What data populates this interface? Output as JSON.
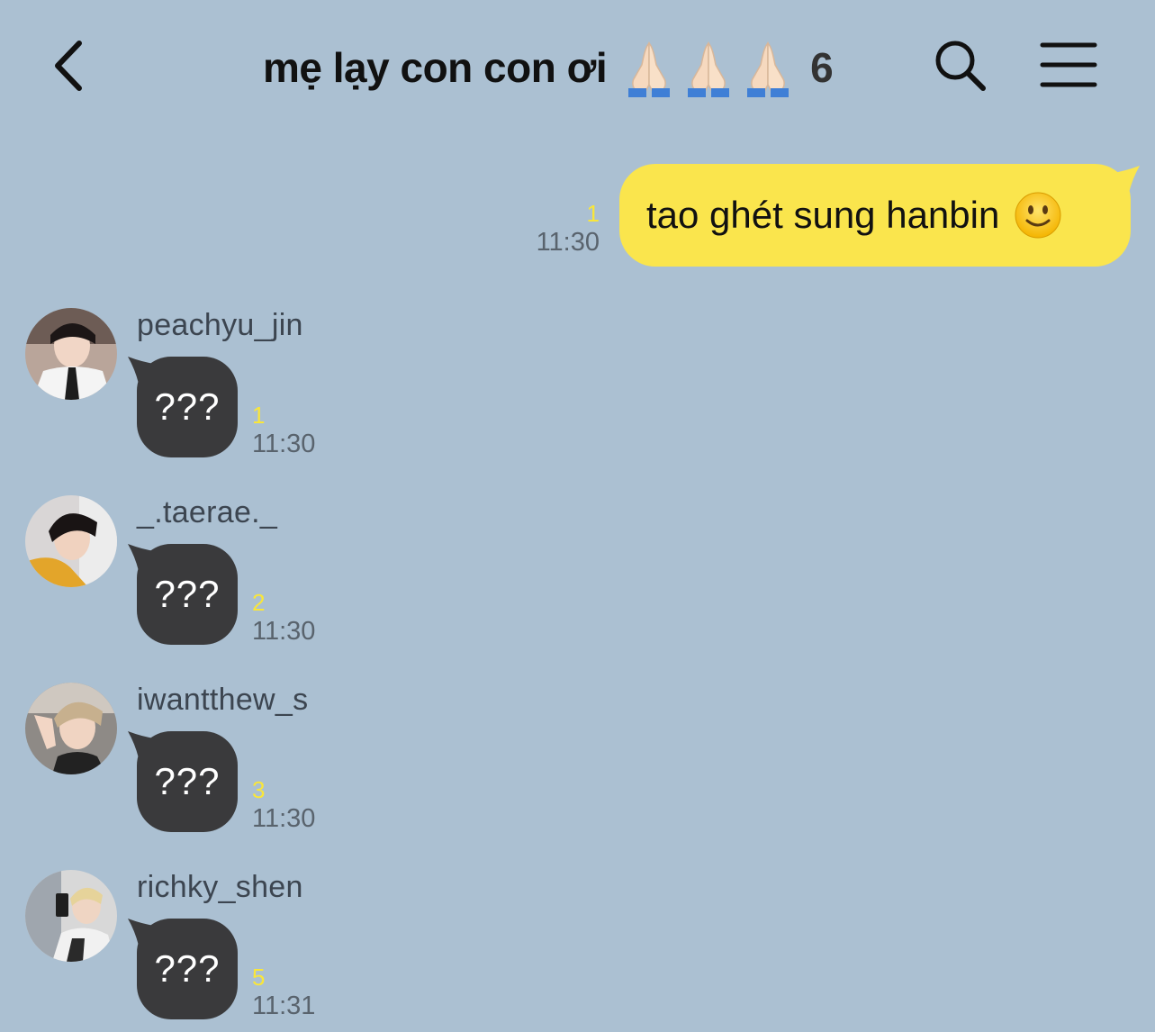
{
  "header": {
    "back_icon": "chevron-left-icon",
    "title": "mẹ lạy con con ơi",
    "title_emoji": [
      "folded-hands",
      "folded-hands",
      "folded-hands"
    ],
    "member_count": "6",
    "search_icon": "search-icon",
    "menu_icon": "hamburger-menu-icon"
  },
  "colors": {
    "background": "#abc0d2",
    "outgoing_bubble": "#fae54d",
    "incoming_bubble": "#3a3a3c",
    "unread_count": "#f9e63a"
  },
  "outgoing": {
    "text": "tao ghét sung hanbin",
    "emoji": "slightly-smiling-face",
    "unread": "1",
    "time": "11:30"
  },
  "messages": [
    {
      "sender": "peachyu_jin",
      "text": "???",
      "unread": "1",
      "time": "11:30"
    },
    {
      "sender": "_.taerae._",
      "text": "???",
      "unread": "2",
      "time": "11:30"
    },
    {
      "sender": "iwantthew_s",
      "text": "???",
      "unread": "3",
      "time": "11:30"
    },
    {
      "sender": "richky_shen",
      "text": "???",
      "unread": "5",
      "time": "11:31"
    }
  ]
}
